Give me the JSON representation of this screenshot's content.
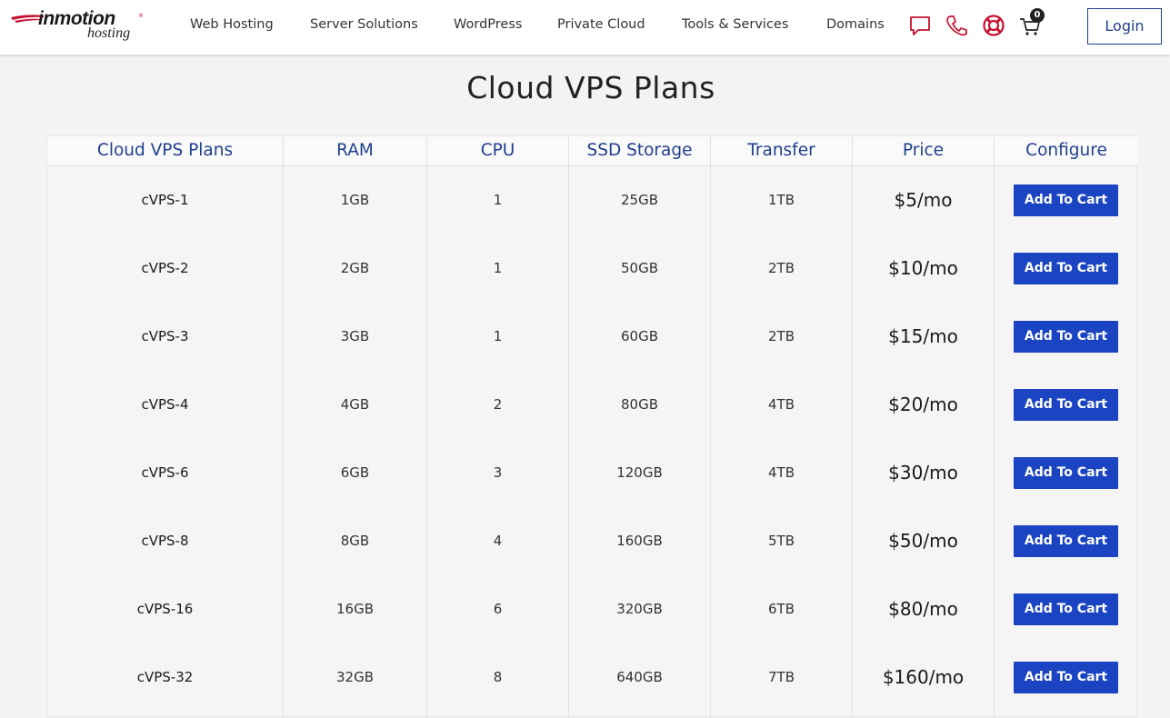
{
  "brand": {
    "name": "inmotion",
    "reg": "®",
    "sub": "hosting"
  },
  "nav": {
    "items": [
      "Web Hosting",
      "Server Solutions",
      "WordPress",
      "Private Cloud",
      "Tools & Services",
      "Domains"
    ],
    "icons": [
      "chat-icon",
      "phone-icon",
      "support-lifebuoy-icon",
      "cart-icon"
    ],
    "cart_count": "0",
    "login_label": "Login"
  },
  "page": {
    "title": "Cloud VPS Plans"
  },
  "table": {
    "headers": [
      "Cloud VPS Plans",
      "RAM",
      "CPU",
      "SSD Storage",
      "Transfer",
      "Price",
      "Configure"
    ],
    "rows": [
      {
        "plan": "cVPS-1",
        "ram": "1GB",
        "cpu": "1",
        "storage": "25GB",
        "transfer": "1TB",
        "price": "$5/mo",
        "action": "Add To Cart"
      },
      {
        "plan": "cVPS-2",
        "ram": "2GB",
        "cpu": "1",
        "storage": "50GB",
        "transfer": "2TB",
        "price": "$10/mo",
        "action": "Add To Cart"
      },
      {
        "plan": "cVPS-3",
        "ram": "3GB",
        "cpu": "1",
        "storage": "60GB",
        "transfer": "2TB",
        "price": "$15/mo",
        "action": "Add To Cart"
      },
      {
        "plan": "cVPS-4",
        "ram": "4GB",
        "cpu": "2",
        "storage": "80GB",
        "transfer": "4TB",
        "price": "$20/mo",
        "action": "Add To Cart"
      },
      {
        "plan": "cVPS-6",
        "ram": "6GB",
        "cpu": "3",
        "storage": "120GB",
        "transfer": "4TB",
        "price": "$30/mo",
        "action": "Add To Cart"
      },
      {
        "plan": "cVPS-8",
        "ram": "8GB",
        "cpu": "4",
        "storage": "160GB",
        "transfer": "5TB",
        "price": "$50/mo",
        "action": "Add To Cart"
      },
      {
        "plan": "cVPS-16",
        "ram": "16GB",
        "cpu": "6",
        "storage": "320GB",
        "transfer": "6TB",
        "price": "$80/mo",
        "action": "Add To Cart"
      },
      {
        "plan": "cVPS-32",
        "ram": "32GB",
        "cpu": "8",
        "storage": "640GB",
        "transfer": "7TB",
        "price": "$160/mo",
        "action": "Add To Cart"
      }
    ]
  },
  "colors": {
    "accent": "#1a44c2",
    "header_text": "#1f3f8f",
    "brand_red": "#c8102e"
  }
}
